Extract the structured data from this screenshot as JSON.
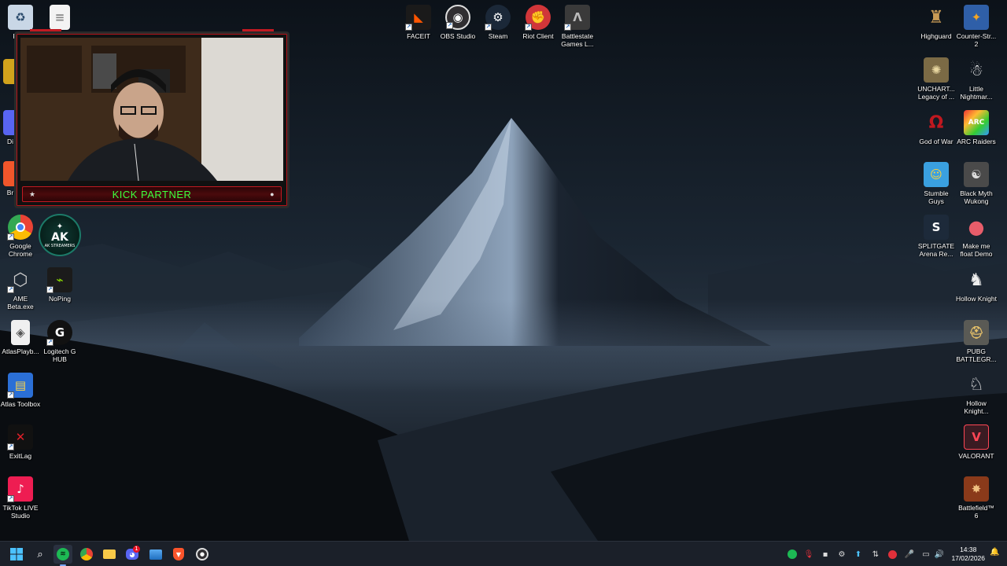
{
  "desktop_icons": {
    "recycle": {
      "label": "Recy",
      "icon": "recycle-bin-icon"
    },
    "top_file": {
      "label": "",
      "icon": "document-icon"
    },
    "faceit": {
      "label": "FACEIT",
      "icon": "faceit-icon",
      "color": "#ff5500"
    },
    "obs": {
      "label": "OBS Studio",
      "icon": "obs-icon",
      "color": "#302e31"
    },
    "steam": {
      "label": "Steam",
      "icon": "steam-icon",
      "color": "#1b2838"
    },
    "riot": {
      "label": "Riot Client",
      "icon": "riot-icon",
      "color": "#d13639"
    },
    "battlestate": {
      "label": "Battlestate Games L...",
      "icon": "battlestate-icon",
      "color": "#3a3a3a"
    },
    "highguard": {
      "label": "Highguard",
      "icon": "highguard-icon",
      "color": "#a37840"
    },
    "counterstrike": {
      "label": "Counter-Str... 2",
      "icon": "counter-strike-icon",
      "color": "#2f5fa8"
    },
    "uncharted": {
      "label": "UNCHART... Legacy of ...",
      "icon": "uncharted-icon",
      "color": "#7b6a45"
    },
    "little_nightmares": {
      "label": "Little Nightmar...",
      "icon": "little-nightmares-icon",
      "color": "#1c1c1c"
    },
    "god_of_war": {
      "label": "God of War",
      "icon": "god-of-war-icon",
      "color": "#c0181f"
    },
    "arc_raiders": {
      "label": "ARC Raiders",
      "icon": "arc-raiders-icon",
      "color": "#222"
    },
    "stumble_guys": {
      "label": "Stumble Guys",
      "icon": "stumble-guys-icon",
      "color": "#3aa0e0"
    },
    "black_myth": {
      "label": "Black Myth Wukong",
      "icon": "black-myth-icon",
      "color": "#4a4a4a"
    },
    "splitgate": {
      "label": "SPLITGATE Arena Re...",
      "icon": "splitgate-icon",
      "color": "#1d2a3a"
    },
    "make_me_float": {
      "label": "Make me float Demo",
      "icon": "balloon-icon",
      "color": "#e85d6a"
    },
    "hollow_knight": {
      "label": "Hollow Knight",
      "icon": "hollow-knight-icon",
      "color": "#e8e8e8"
    },
    "pubg": {
      "label": "PUBG BATTLEGR...",
      "icon": "pubg-icon",
      "color": "#5a5a55"
    },
    "hollow_knight_silk": {
      "label": "Hollow Knight...",
      "icon": "hollow-knight-silksong-icon",
      "color": "#e8e8e8"
    },
    "valorant": {
      "label": "VALORANT",
      "icon": "valorant-icon",
      "color": "#3a1b22"
    },
    "battlefield": {
      "label": "Battlefield™ 6",
      "icon": "battlefield-icon",
      "color": "#8a3a1a"
    },
    "chrome": {
      "label": "Google Chrome",
      "icon": "chrome-icon"
    },
    "ak_streamers": {
      "label": "",
      "icon": "ak-streamers-logo-icon",
      "logo_text": "AK STREAMERS"
    },
    "ame": {
      "label": "AME Beta.exe",
      "icon": "ame-icon"
    },
    "noping": {
      "label": "NoPing",
      "icon": "noping-icon",
      "color": "#1b1b1b"
    },
    "atlas_playbook": {
      "label": "AtlasPlayb...",
      "icon": "atlas-playbook-icon"
    },
    "logitech": {
      "label": "Logitech G HUB",
      "icon": "logitech-g-icon",
      "color": "#111"
    },
    "atlas_toolbox": {
      "label": "Atlas Toolbox",
      "icon": "atlas-toolbox-icon",
      "color": "#2b6fd6"
    },
    "exitlag": {
      "label": "ExitLag",
      "icon": "exitlag-icon",
      "color": "#111"
    },
    "tiktok": {
      "label": "TikTok LIVE Studio",
      "icon": "tiktok-live-icon",
      "color": "#ee1d52"
    },
    "partial_1": {
      "label": "",
      "icon": "partial-icon"
    },
    "partial_2": {
      "label": "Di",
      "icon": "discord-partial-icon"
    },
    "partial_3": {
      "label": "Br",
      "icon": "brave-partial-icon"
    }
  },
  "webcam": {
    "banner_text": "KICK PARTNER",
    "accent": "#c21a22",
    "text_color": "#3dff3d"
  },
  "taskbar": {
    "apps": [
      {
        "name": "start-button",
        "icon": "windows-logo-icon"
      },
      {
        "name": "search-button",
        "icon": "search-icon"
      },
      {
        "name": "spotify-taskbar",
        "icon": "spotify-icon"
      },
      {
        "name": "chrome-taskbar",
        "icon": "chrome-icon"
      },
      {
        "name": "file-explorer-taskbar",
        "icon": "folder-icon"
      },
      {
        "name": "discord-taskbar",
        "icon": "discord-icon",
        "badge": "1"
      },
      {
        "name": "photos-taskbar",
        "icon": "photos-icon"
      },
      {
        "name": "brave-taskbar",
        "icon": "brave-icon"
      },
      {
        "name": "obs-taskbar",
        "icon": "obs-icon"
      }
    ],
    "time": "14:38",
    "date": "17/02/2026"
  }
}
